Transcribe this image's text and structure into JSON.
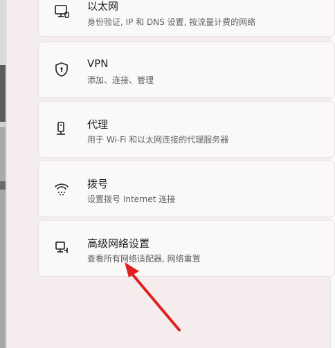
{
  "settings": {
    "items": [
      {
        "title": "以太网",
        "subtitle": "身份验证, IP 和 DNS 设置, 按流量计费的网络",
        "icon": "ethernet-icon"
      },
      {
        "title": "VPN",
        "subtitle": "添加、连接、管理",
        "icon": "shield-icon"
      },
      {
        "title": "代理",
        "subtitle": "用于 Wi-Fi 和以太网连接的代理服务器",
        "icon": "proxy-icon"
      },
      {
        "title": "拨号",
        "subtitle": "设置拨号 Internet 连接",
        "icon": "dialup-icon"
      },
      {
        "title": "高级网络设置",
        "subtitle": "查看所有网络适配器, 网络重置",
        "icon": "network-adapter-icon"
      }
    ]
  },
  "annotation": {
    "arrow_color": "#e02020"
  }
}
